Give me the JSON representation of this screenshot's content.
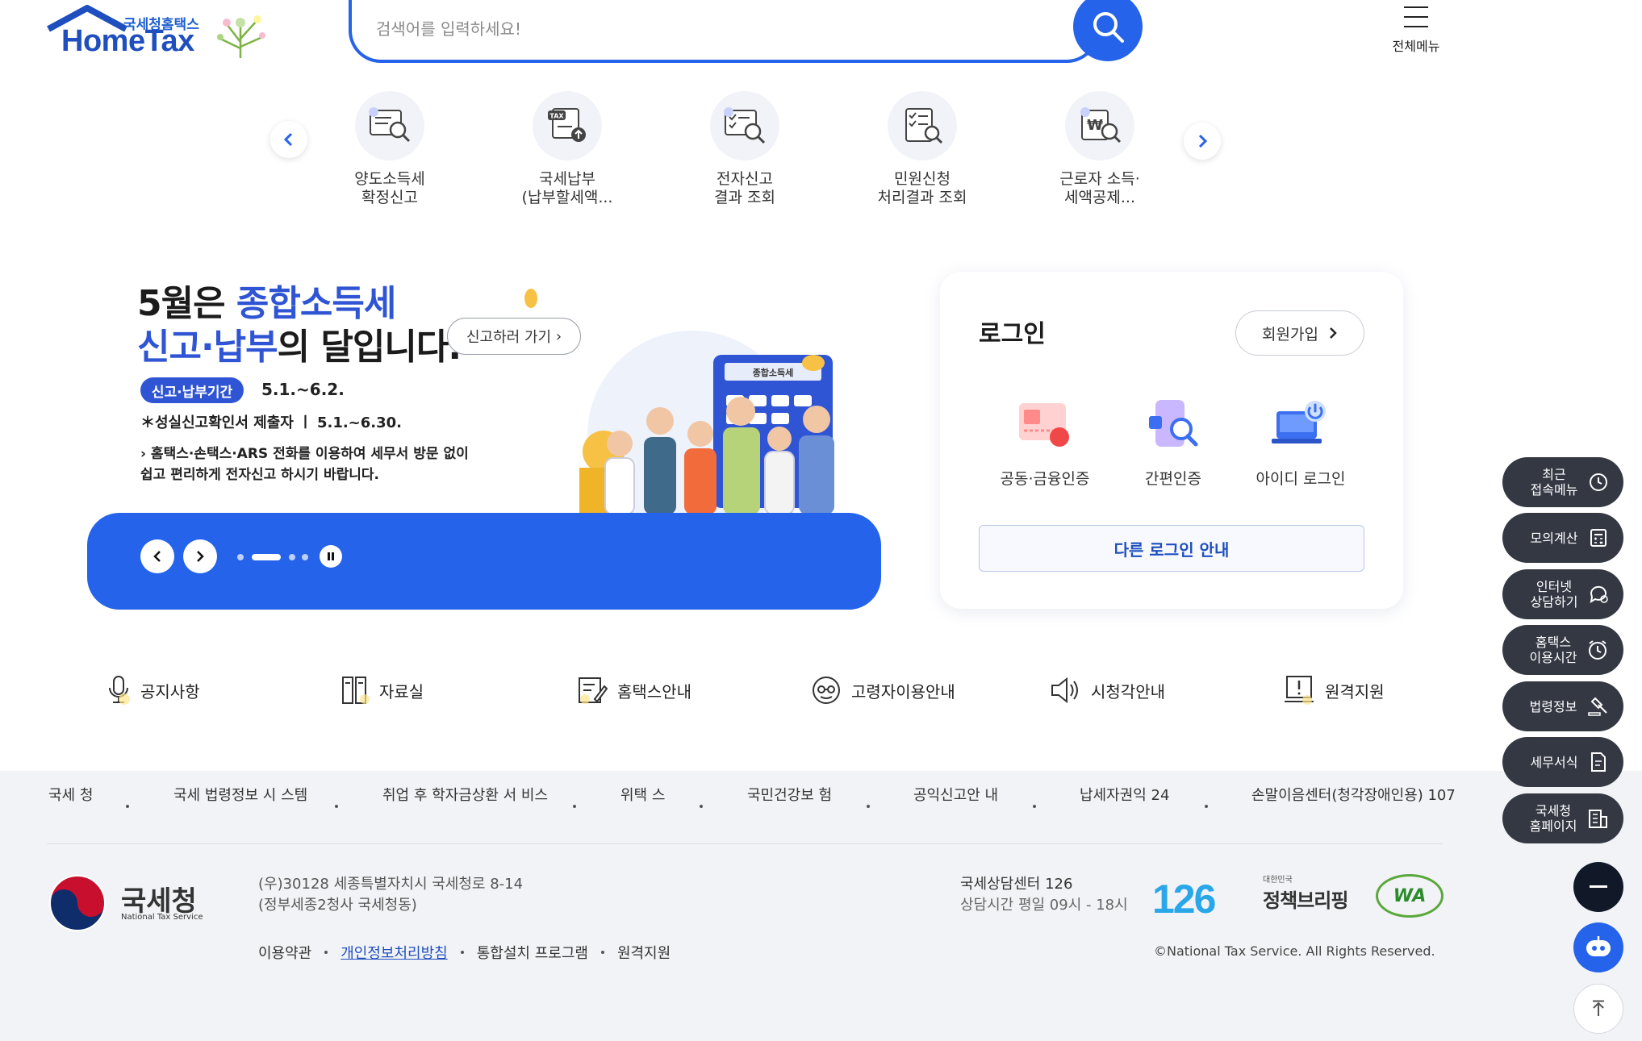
{
  "header": {
    "logo_sub": "국세청홈택스",
    "logo_main": "HomeTax",
    "search_placeholder": "검색어를 입력하세요!",
    "all_menu_label": "전체메뉴"
  },
  "quick_menu": [
    {
      "label": "양도소득세\n확정신고",
      "icon": "doc-search-icon"
    },
    {
      "label": "국세납부\n(납부할세액...",
      "icon": "tax-upload-icon"
    },
    {
      "label": "전자신고\n결과 조회",
      "icon": "doc-check-icon"
    },
    {
      "label": "민원신청\n처리결과 조회",
      "icon": "doc-list-icon"
    },
    {
      "label": "근로자 소득·\n세액공제...",
      "icon": "won-search-icon"
    }
  ],
  "banner": {
    "line1_a": "5월은 ",
    "line1_b": "종합소득세",
    "line2_a": "신고·납부",
    "line2_b": "의 달입니다.",
    "go_button": "신고하러 가기",
    "period_tag": "신고·납부기간",
    "period": "5.1.~6.2.",
    "line_faithful": "＊성실신고확인서 제출자 ㅣ 5.1.~6.30.",
    "line_guide": "› 홈택스·손택스·ARS 전화를 이용하여 세무서 방문 없이\n쉽고 편리하게 전자신고 하시기 바랍니다.",
    "calculator_label": "종합소득세"
  },
  "login": {
    "title": "로그인",
    "signup": "회원가입",
    "options": [
      {
        "label": "공동·금융인증",
        "icon": "certificate-icon"
      },
      {
        "label": "간편인증",
        "icon": "phone-auth-icon"
      },
      {
        "label": "아이디 로그인",
        "icon": "id-login-icon"
      }
    ],
    "other": "다른 로그인 안내"
  },
  "info_links": [
    {
      "label": "공지사항",
      "icon": "microphone-icon"
    },
    {
      "label": "자료실",
      "icon": "archive-icon"
    },
    {
      "label": "홈택스안내",
      "icon": "guide-edit-icon"
    },
    {
      "label": "고령자이용안내",
      "icon": "elderly-icon"
    },
    {
      "label": "시청각안내",
      "icon": "speaker-icon"
    },
    {
      "label": "원격지원",
      "icon": "remote-support-icon"
    }
  ],
  "footer": {
    "links": [
      "국세\n청",
      "국세 법령정보 시\n스템",
      "취업 후 학자금상환 서\n비스",
      "위택\n스",
      "국민건강보\n험",
      "공익신고안\n내",
      "납세자권익\n24",
      "손말이음센터(청각장애인용)\n107"
    ],
    "org_name": "국세청",
    "org_en": "National Tax Service",
    "address": "(우)30128 세종특별자치시 국세청로 8-14\n(정부세종2청사 국세청동)",
    "bottom_links": [
      "이용약관",
      "개인정보처리방침",
      "통합설치 프로그램",
      "원격지원"
    ],
    "call_center": "국세상담센터 126",
    "call_hours": "상담시간 평일 09시 - 18시",
    "badge_126": "126",
    "policy_top": "대한민국",
    "policy_main": "정책브리핑",
    "wa_label": "WA",
    "copyright": "©National Tax Service. All Rights Reserved."
  },
  "floating": [
    {
      "label": "최근\n접속메뉴",
      "icon": "clock-icon"
    },
    {
      "label": "모의계산",
      "icon": "calculator-icon"
    },
    {
      "label": "인터넷\n상담하기",
      "icon": "chat-icon"
    },
    {
      "label": "홈택스\n이용시간",
      "icon": "alarm-icon"
    },
    {
      "label": "법령정보",
      "icon": "gavel-icon"
    },
    {
      "label": "세무서식",
      "icon": "form-icon"
    },
    {
      "label": "국세청\n홈페이지",
      "icon": "building-icon"
    }
  ],
  "colors": {
    "primary": "#2563eb",
    "dark": "#333843",
    "text": "#222222"
  }
}
